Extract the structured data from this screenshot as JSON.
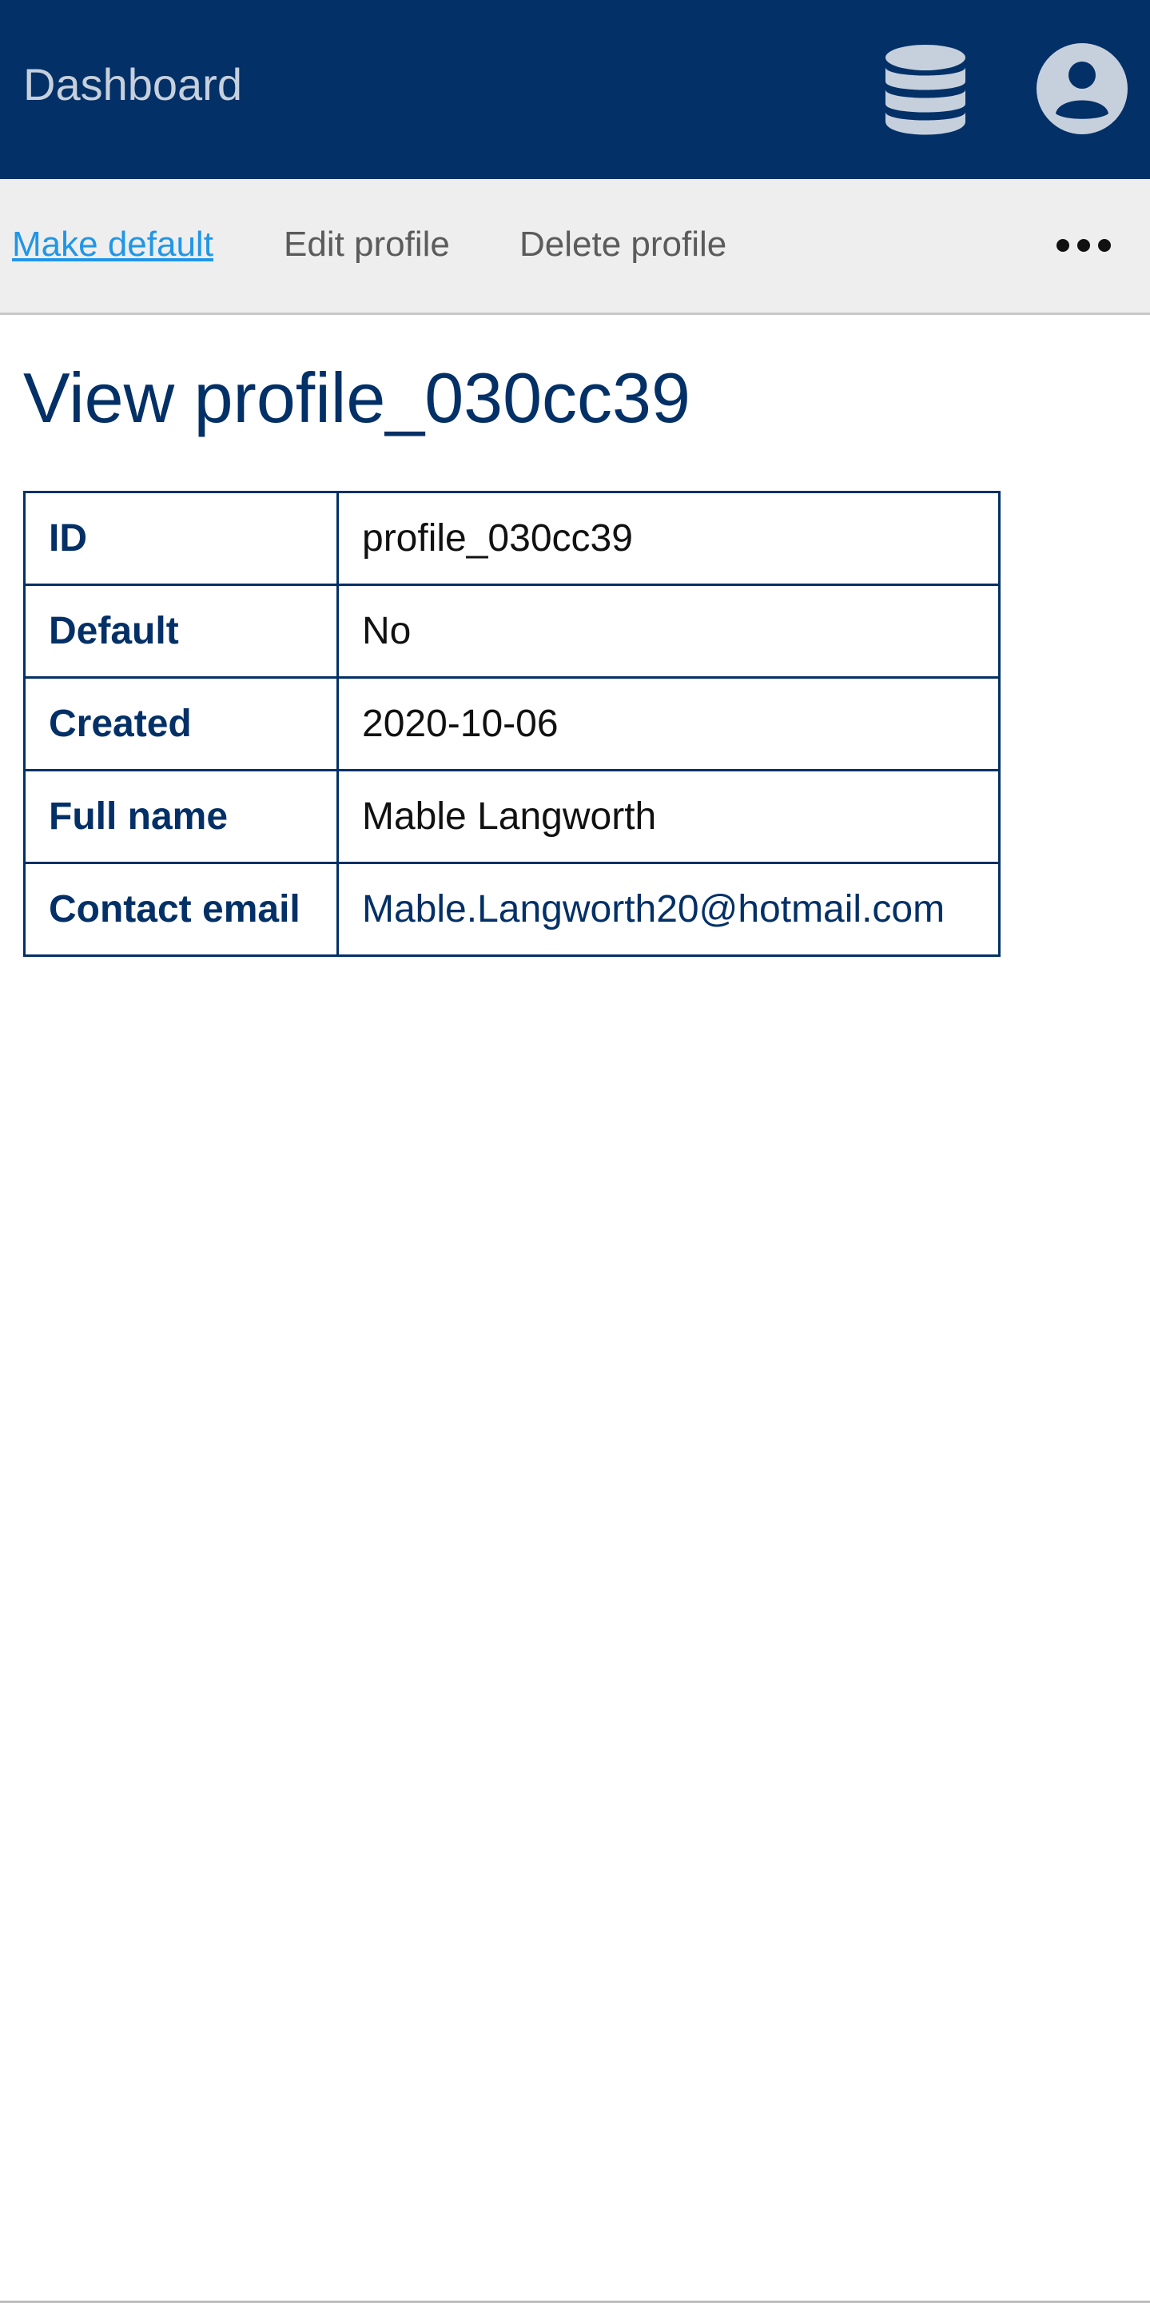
{
  "header": {
    "title": "Dashboard",
    "icons": [
      "database-icon",
      "user-avatar-icon"
    ],
    "colors": {
      "bar": "#033066",
      "icon": "#c6d0dd"
    }
  },
  "toolbar": {
    "make_default": "Make default",
    "edit_profile": "Edit profile",
    "delete_profile": "Delete profile",
    "more_icon": "more-horizontal-icon",
    "colors": {
      "link": "#2196e6",
      "action": "#5b5b5b",
      "background": "#eeeeee"
    }
  },
  "main": {
    "title": "View profile_030cc39",
    "details": [
      {
        "label": "ID",
        "value": "profile_030cc39"
      },
      {
        "label": "Default",
        "value": "No"
      },
      {
        "label": "Created",
        "value": "2020-10-06"
      },
      {
        "label": "Full name",
        "value": "Mable Langworth"
      },
      {
        "label": "Contact email",
        "value": "Mable.Langworth20@hotmail.com"
      }
    ]
  }
}
